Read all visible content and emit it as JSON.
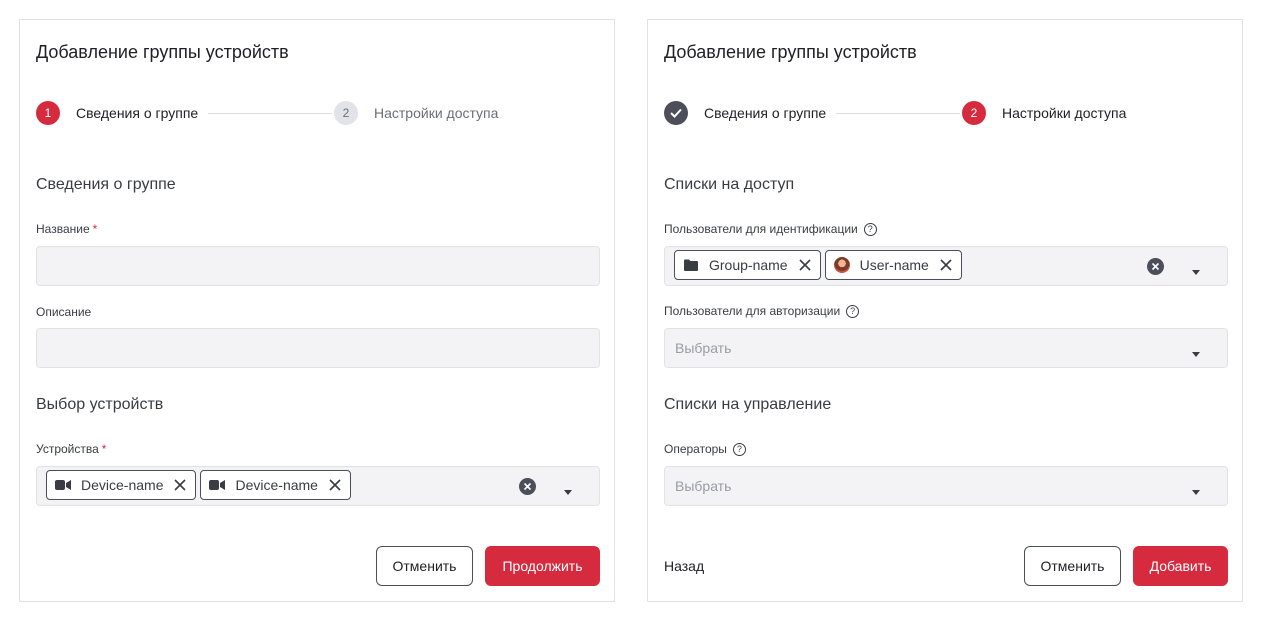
{
  "left": {
    "title": "Добавление группы устройств",
    "steps": [
      {
        "number": "1",
        "label": "Сведения о группе"
      },
      {
        "number": "2",
        "label": "Настройки доступа"
      }
    ],
    "section_info": "Сведения о группе",
    "name_label": "Название",
    "description_label": "Описание",
    "section_devices": "Выбор устройств",
    "devices_label": "Устройства",
    "required_mark": "*",
    "device_chips": [
      {
        "label": "Device-name",
        "icon": "video-camera-icon"
      },
      {
        "label": "Device-name",
        "icon": "video-camera-icon"
      }
    ],
    "cancel_label": "Отменить",
    "continue_label": "Продолжить"
  },
  "right": {
    "title": "Добавление группы устройств",
    "steps": [
      {
        "number": "",
        "label": "Сведения о группе"
      },
      {
        "number": "2",
        "label": "Настройки доступа"
      }
    ],
    "section_access": "Списки на доступ",
    "ident_label": "Пользователи для идентификации",
    "ident_chips": [
      {
        "label": "Group-name",
        "icon": "folder-icon"
      },
      {
        "label": "User-name",
        "icon": "avatar"
      }
    ],
    "auth_label": "Пользователи для авторизации",
    "auth_placeholder": "Выбрать",
    "section_manage": "Списки на управление",
    "operators_label": "Операторы",
    "operators_placeholder": "Выбрать",
    "help_glyph": "?",
    "back_label": "Назад",
    "cancel_label": "Отменить",
    "add_label": "Добавить"
  },
  "colors": {
    "accent": "#d62b3f",
    "done_step": "#4c4f59",
    "field_bg": "#f3f3f5"
  }
}
